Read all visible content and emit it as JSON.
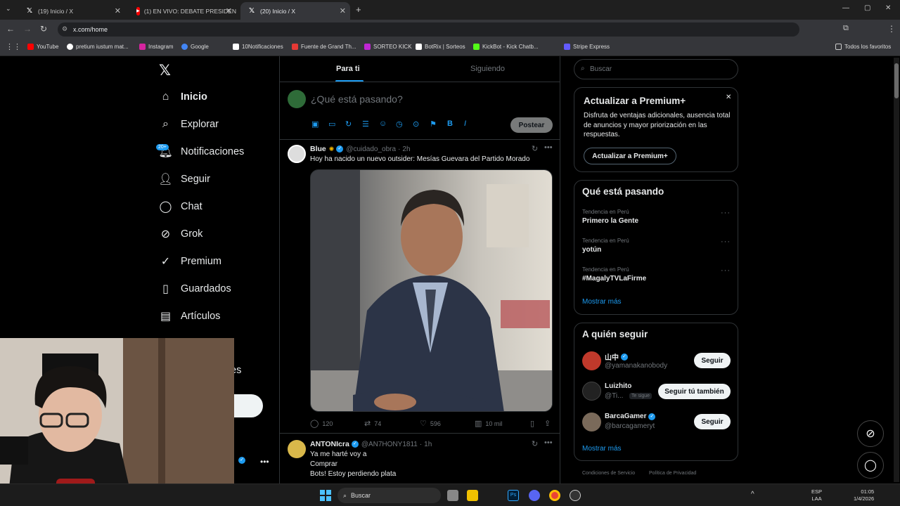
{
  "browser": {
    "tabs": [
      {
        "title": "(19) Inicio / X",
        "favicon": "x-logo"
      },
      {
        "title": "(1) EN VIVO: DEBATE PRESIDEN",
        "favicon": "youtube-logo"
      },
      {
        "title": "(20) Inicio / X",
        "favicon": "x-logo",
        "active": true
      }
    ],
    "url": "x.com/home",
    "bookmarks": [
      {
        "label": "YouTube",
        "color": "#ff0000"
      },
      {
        "label": "pretium iustum mat...",
        "color": "#ffffff"
      },
      {
        "label": "Instagram",
        "color": "#d6249f"
      },
      {
        "label": "Google",
        "color": "#4285f4"
      },
      {
        "label": "10Notificaciones",
        "color": "#ffffff"
      },
      {
        "label": "Fuente de Grand Th...",
        "color": "#e53935"
      },
      {
        "label": "SORTEO KICK",
        "color": "#c026d3"
      },
      {
        "label": "BotRix | Sorteos",
        "color": "#ffffff"
      },
      {
        "label": "KickBot - Kick Chatb...",
        "color": "#53fc18"
      },
      {
        "label": "Stripe Express",
        "color": "#635bff"
      }
    ],
    "all_bookmarks": "Todos los favoritos"
  },
  "nav": {
    "items": [
      {
        "label": "Inicio",
        "icon": "home-icon",
        "active": true
      },
      {
        "label": "Explorar",
        "icon": "search-icon"
      },
      {
        "label": "Notificaciones",
        "icon": "bell-icon",
        "badge": "20+"
      },
      {
        "label": "Seguir",
        "icon": "follow-icon"
      },
      {
        "label": "Chat",
        "icon": "chat-icon"
      },
      {
        "label": "Grok",
        "icon": "grok-icon"
      },
      {
        "label": "Premium",
        "icon": "premium-icon"
      },
      {
        "label": "Guardados",
        "icon": "bookmark-icon"
      },
      {
        "label": "Artículos",
        "icon": "articles-icon"
      }
    ],
    "partial_label": "es"
  },
  "feed": {
    "tabs": [
      "Para ti",
      "Siguiendo"
    ],
    "compose_placeholder": "¿Qué está pasando?",
    "post_button": "Postear",
    "tweets": [
      {
        "name": "Blue",
        "handle": "@cuidado_obra",
        "time": "2h",
        "text": "Hoy ha nacido un nuevo outsider: Mesías Guevara del Partido Morado",
        "replies": "120",
        "reposts": "74",
        "likes": "596",
        "views": "10 mil"
      },
      {
        "name": "ANTONIcra",
        "handle": "@AN7HONY1811",
        "time": "1h",
        "lines": [
          "Ya me harté voy a",
          "Comprar",
          "Bots! Estoy perdiendo plata"
        ]
      }
    ]
  },
  "sidebar": {
    "search_placeholder": "Buscar",
    "premium": {
      "title": "Actualizar a Premium+",
      "body": "Disfruta de ventajas adicionales, ausencia total de anuncios y mayor priorización en las respuestas.",
      "button": "Actualizar a Premium+"
    },
    "trends_title": "Qué está pasando",
    "trends": [
      {
        "category": "Tendencia en Perú",
        "name": "Primero la Gente"
      },
      {
        "category": "Tendencia en Perú",
        "name": "yotún"
      },
      {
        "category": "Tendencia en Perú",
        "name": "#MagalyTVLaFirme"
      }
    ],
    "show_more": "Mostrar más",
    "follow_title": "A quién seguir",
    "follow": [
      {
        "name": "山中",
        "handle": "@yamanakanobody",
        "button": "Seguir",
        "verified": true
      },
      {
        "name": "Luizhito",
        "handle": "@Ti...",
        "follows_you": "Te sigue",
        "button": "Seguir tú también"
      },
      {
        "name": "BarcaGamer",
        "handle": "@barcagameryt",
        "button": "Seguir",
        "verified": true
      }
    ],
    "footer": [
      "Condiciones de Servicio",
      "Política de Privacidad"
    ]
  },
  "taskbar": {
    "search": "Buscar",
    "lang": "ESP",
    "lang2": "LAA",
    "time": "01:05",
    "date": "1/4/2026"
  }
}
